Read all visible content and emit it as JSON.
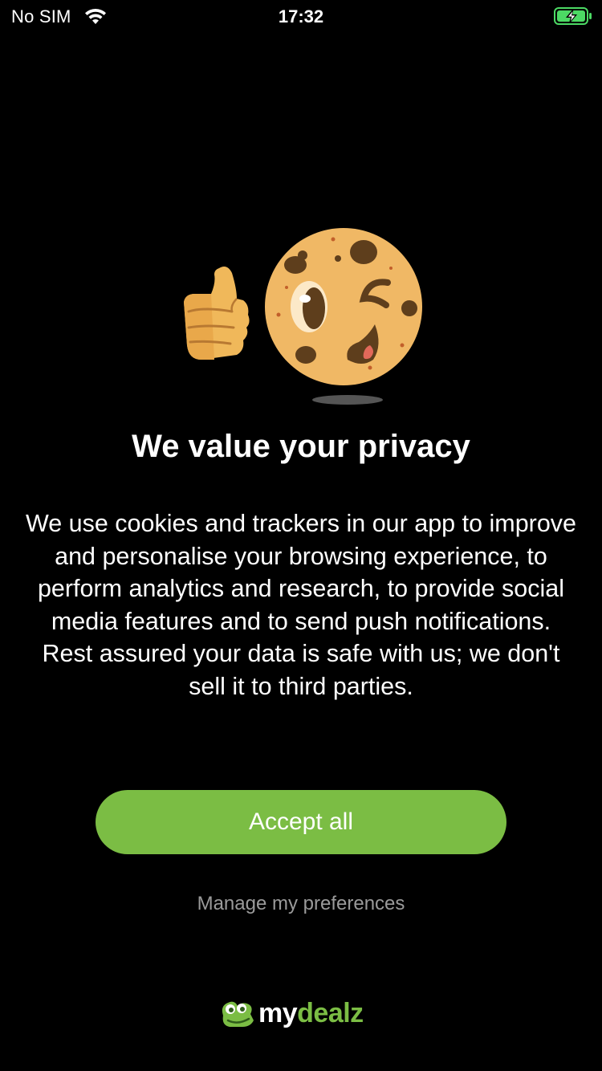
{
  "status_bar": {
    "carrier": "No SIM",
    "time": "17:32",
    "wifi_icon": "wifi-icon",
    "battery_icon": "battery-charging-icon",
    "battery_color": "#4cd964"
  },
  "illustration": {
    "icons": [
      "thumbs-up-icon",
      "winking-cookie-icon"
    ]
  },
  "content": {
    "title": "We value your privacy",
    "body": "We use cookies and trackers in our app to improve and personalise your browsing experience, to perform analytics and research, to provide social media features and to send push notifications. Rest assured your data is safe with us; we don't sell it to third parties."
  },
  "actions": {
    "accept_label": "Accept all",
    "manage_label": "Manage my preferences"
  },
  "brand": {
    "name_part1": "my",
    "name_part2": "dealz",
    "accent_color": "#7bbd44"
  }
}
